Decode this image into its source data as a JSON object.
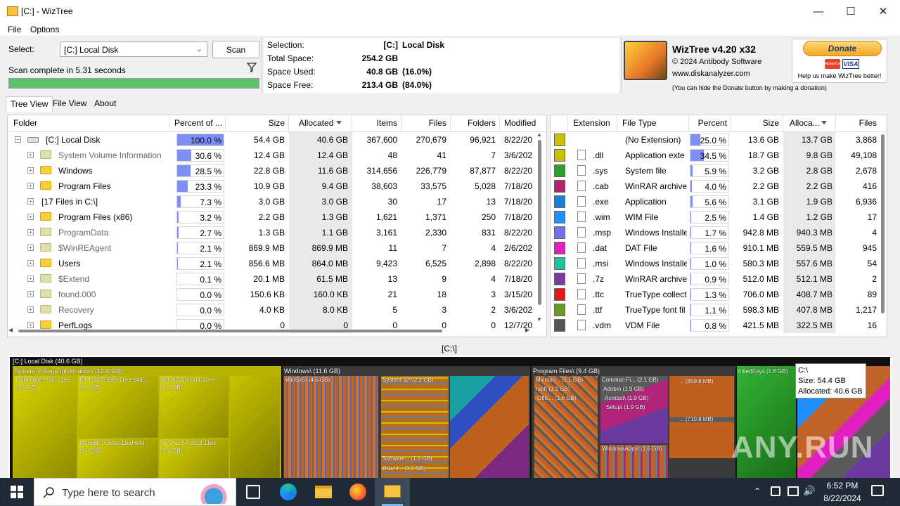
{
  "window": {
    "title": "[C:]  - WizTree"
  },
  "menu": [
    "File",
    "Options"
  ],
  "select": {
    "label": "Select:",
    "drive": "[C:] Local Disk",
    "scan_label": "Scan",
    "status": "Scan complete in 5.31 seconds",
    "progress": 100
  },
  "info": {
    "selection_label": "Selection:",
    "selection_drive": "[C:]",
    "selection_name": "Local Disk",
    "total_label": "Total Space:",
    "total": "254.2 GB",
    "used_label": "Space Used:",
    "used": "40.8 GB",
    "used_pct": "(16.0%)",
    "free_label": "Space Free:",
    "free": "213.4 GB",
    "free_pct": "(84.0%)"
  },
  "brand": {
    "name": "WizTree v4.20 x32",
    "copyright": "© 2024 Antibody Software",
    "site": "www.diskanalyzer.com",
    "hint": "(You can hide the Donate button by making a donation)"
  },
  "donate": {
    "label": "Donate",
    "card1": "MasterCard",
    "card2": "VISA",
    "note": "Help us make WizTree better!"
  },
  "tabs": [
    "Tree View",
    "File View",
    "About"
  ],
  "tree": {
    "headers": [
      "Folder",
      "Percent of ...",
      "Size",
      "Allocated",
      "Items",
      "Files",
      "Folders",
      "Modified"
    ],
    "rows": [
      {
        "name": "[C:] Local Disk",
        "pct": "100.0 %",
        "pctv": 100,
        "size": "54.4 GB",
        "alloc": "40.6 GB",
        "items": "367,600",
        "files": "270,679",
        "folders": "96,921",
        "mod": "8/22/20",
        "icon": "drive-icon",
        "indent": 0,
        "sys": false
      },
      {
        "name": "System Volume Information",
        "pct": "30.6 %",
        "pctv": 30.6,
        "size": "12.4 GB",
        "alloc": "12.4 GB",
        "items": "48",
        "files": "41",
        "folders": "7",
        "mod": "3/6/202",
        "icon": "system-folder-icon",
        "indent": 1,
        "sys": true
      },
      {
        "name": "Windows",
        "pct": "28.5 %",
        "pctv": 28.5,
        "size": "22.8 GB",
        "alloc": "11.6 GB",
        "items": "314,656",
        "files": "226,779",
        "folders": "87,877",
        "mod": "8/22/20",
        "icon": "folder-icon",
        "indent": 1,
        "sys": false
      },
      {
        "name": "Program Files",
        "pct": "23.3 %",
        "pctv": 23.3,
        "size": "10.9 GB",
        "alloc": "9.4 GB",
        "items": "38,603",
        "files": "33,575",
        "folders": "5,028",
        "mod": "7/18/20",
        "icon": "folder-icon",
        "indent": 1,
        "sys": false
      },
      {
        "name": "[17 Files in C:\\]",
        "pct": "7.3 %",
        "pctv": 7.3,
        "size": "3.0 GB",
        "alloc": "3.0 GB",
        "items": "30",
        "files": "17",
        "folders": "13",
        "mod": "7/18/20",
        "icon": "",
        "indent": 1,
        "sys": false
      },
      {
        "name": "Program Files (x86)",
        "pct": "3.2 %",
        "pctv": 3.2,
        "size": "2.2 GB",
        "alloc": "1.3 GB",
        "items": "1,621",
        "files": "1,371",
        "folders": "250",
        "mod": "7/18/20",
        "icon": "folder-icon",
        "indent": 1,
        "sys": false
      },
      {
        "name": "ProgramData",
        "pct": "2.7 %",
        "pctv": 2.7,
        "size": "1.3 GB",
        "alloc": "1.1 GB",
        "items": "3,161",
        "files": "2,330",
        "folders": "831",
        "mod": "8/22/20",
        "icon": "hidden-folder-icon",
        "indent": 1,
        "sys": true
      },
      {
        "name": "$WinREAgent",
        "pct": "2.1 %",
        "pctv": 2.1,
        "size": "869.9 MB",
        "alloc": "869.9 MB",
        "items": "11",
        "files": "7",
        "folders": "4",
        "mod": "2/6/202",
        "icon": "hidden-folder-icon",
        "indent": 1,
        "sys": true
      },
      {
        "name": "Users",
        "pct": "2.1 %",
        "pctv": 2.1,
        "size": "856.6 MB",
        "alloc": "864.0 MB",
        "items": "9,423",
        "files": "6,525",
        "folders": "2,898",
        "mod": "8/22/20",
        "icon": "folder-icon",
        "indent": 1,
        "sys": false
      },
      {
        "name": "$Extend",
        "pct": "0.1 %",
        "pctv": 0.1,
        "size": "20.1 MB",
        "alloc": "61.5 MB",
        "items": "13",
        "files": "9",
        "folders": "4",
        "mod": "7/18/20",
        "icon": "system-folder-icon",
        "indent": 1,
        "sys": true
      },
      {
        "name": "found.000",
        "pct": "0.0 %",
        "pctv": 0,
        "size": "150.6 KB",
        "alloc": "160.0 KB",
        "items": "21",
        "files": "18",
        "folders": "3",
        "mod": "3/15/20",
        "icon": "system-folder-icon",
        "indent": 1,
        "sys": true
      },
      {
        "name": "Recovery",
        "pct": "0.0 %",
        "pctv": 0,
        "size": "4.0 KB",
        "alloc": "8.0 KB",
        "items": "5",
        "files": "3",
        "folders": "2",
        "mod": "3/6/202",
        "icon": "system-folder-icon",
        "indent": 1,
        "sys": true
      },
      {
        "name": "PerfLogs",
        "pct": "0.0 %",
        "pctv": 0,
        "size": "0",
        "alloc": "0",
        "items": "0",
        "files": "0",
        "folders": "0",
        "mod": "12/7/20",
        "icon": "folder-icon",
        "indent": 1,
        "sys": false
      }
    ]
  },
  "filetypes": {
    "headers": [
      "Extension",
      "File Type",
      "Percent",
      "Size",
      "Alloca...",
      "Files"
    ],
    "rows": [
      {
        "color": "#c8c000",
        "ext": "",
        "type": "(No Extension)",
        "pct": "25.0 %",
        "pctv": 25,
        "size": "13.6 GB",
        "alloc": "13.7 GB",
        "files": "3,868"
      },
      {
        "color": "#c8c000",
        "ext": ".dll",
        "type": "Application exte",
        "pct": "34.5 %",
        "pctv": 34.5,
        "size": "18.7 GB",
        "alloc": "9.8 GB",
        "files": "49,108"
      },
      {
        "color": "#2ea02e",
        "ext": ".sys",
        "type": "System file",
        "pct": "5.9 %",
        "pctv": 5.9,
        "size": "3.2 GB",
        "alloc": "2.8 GB",
        "files": "2,678"
      },
      {
        "color": "#b0246a",
        "ext": ".cab",
        "type": "WinRAR archive",
        "pct": "4.0 %",
        "pctv": 4,
        "size": "2.2 GB",
        "alloc": "2.2 GB",
        "files": "416"
      },
      {
        "color": "#1a7fd4",
        "ext": ".exe",
        "type": "Application",
        "pct": "5.6 %",
        "pctv": 5.6,
        "size": "3.1 GB",
        "alloc": "1.9 GB",
        "files": "6,936"
      },
      {
        "color": "#1e90ff",
        "ext": ".wim",
        "type": "WIM File",
        "pct": "2.5 %",
        "pctv": 2.5,
        "size": "1.4 GB",
        "alloc": "1.2 GB",
        "files": "17"
      },
      {
        "color": "#7070f0",
        "ext": ".msp",
        "type": "Windows Installe",
        "pct": "1.7 %",
        "pctv": 1.7,
        "size": "942.8 MB",
        "alloc": "940.3 MB",
        "files": "4"
      },
      {
        "color": "#e020c0",
        "ext": ".dat",
        "type": "DAT File",
        "pct": "1.6 %",
        "pctv": 1.6,
        "size": "910.1 MB",
        "alloc": "559.5 MB",
        "files": "945"
      },
      {
        "color": "#20c0a0",
        "ext": ".msi",
        "type": "Windows Installe",
        "pct": "1.0 %",
        "pctv": 1,
        "size": "580.3 MB",
        "alloc": "557.6 MB",
        "files": "54"
      },
      {
        "color": "#7a3aa0",
        "ext": ".7z",
        "type": "WinRAR archive",
        "pct": "0.9 %",
        "pctv": 0.9,
        "size": "512.0 MB",
        "alloc": "512.1 MB",
        "files": "2"
      },
      {
        "color": "#e01818",
        "ext": ".ttc",
        "type": "TrueType collecti",
        "pct": "1.3 %",
        "pctv": 1.3,
        "size": "706.0 MB",
        "alloc": "408.7 MB",
        "files": "89"
      },
      {
        "color": "#6a9a20",
        "ext": ".ttf",
        "type": "TrueType font fil",
        "pct": "1.1 %",
        "pctv": 1.1,
        "size": "598.3 MB",
        "alloc": "407.8 MB",
        "files": "1,217"
      },
      {
        "color": "#555555",
        "ext": ".vdm",
        "type": "VDM File",
        "pct": "0.8 %",
        "pctv": 0.8,
        "size": "421.5 MB",
        "alloc": "322.5 MB",
        "files": "16"
      }
    ]
  },
  "treemap": {
    "path": "[C:\\]",
    "root": "[C:] Local Disk  (40.6 GB)",
    "labels": [
      "System Volume Information\\ (12.4 GB)",
      "{7dbed00e-c50c-11ee",
      "(3.0 GB)",
      "{9fcf7b23-99a9-11ee-b4d5",
      "(2.0 GB)",
      "{93102226-c4f4-11ee-",
      "(1.7 GB)",
      "{4a56df70-38a5-11ed-b4d",
      "(1.8 GB)",
      "{37141754-3319-11ee",
      "(1.6 GB)",
      "Windows\\ (11.6 GB)",
      "WinSxS\\ (4.6 GB)",
      "System 32\\ (2.2 GB)",
      "Software... (1.1 GB)",
      "Downl... (1.1 GB)",
      "Program Files\\ (9.4 GB)",
      "Microso... (3.1 GB)",
      "root\\ (3.1 GB)",
      "Offic... (1.6 GB)",
      "Common Fi... (2.1 GB)",
      "Adobe\\ (1.9 GB)",
      "Acrobat\\ (1.9 GB)",
      "Setup\\ (1.9 GB)",
      "WindowsApps\\ (1.6 GB)",
      "... (859.6 MB)",
      "... (710.8 MB)",
      "hiberfil.sys (1.6 GB)"
    ],
    "tooltip": {
      "path": "C:\\",
      "size": "Size: 54.4 GB",
      "alloc": "Allocated: 40.6 GB"
    }
  },
  "taskbar": {
    "search_placeholder": "Type here to search",
    "time": "6:52 PM",
    "date": "8/22/2024"
  },
  "watermark": "ANY.RUN"
}
